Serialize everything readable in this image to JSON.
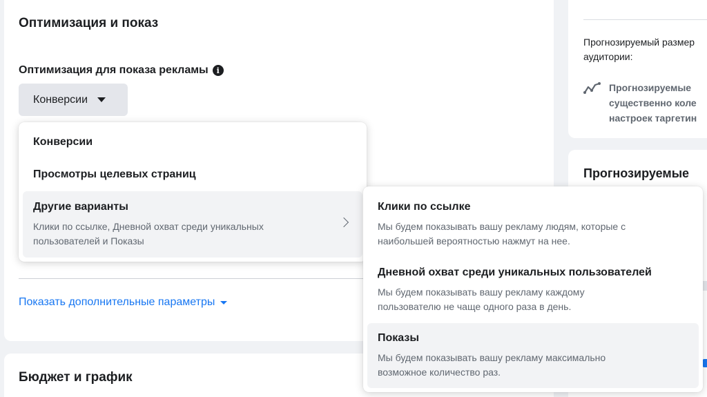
{
  "optimization": {
    "section_title": "Оптимизация и показ",
    "field_label": "Оптимизация для показа рекламы",
    "info_icon": "info-icon",
    "selected_value": "Конверсии",
    "show_more_link": "Показать дополнительные параметры"
  },
  "dropdown": {
    "items": [
      {
        "title": "Конверсии"
      },
      {
        "title": "Просмотры целевых страниц"
      },
      {
        "title": "Другие варианты",
        "description_line1": "Клики по ссылке, Дневной охват среди уникальных",
        "description_line2": "пользователей и Показы"
      }
    ]
  },
  "submenu": {
    "items": [
      {
        "title": "Клики по ссылке",
        "description_line1": "Мы будем показывать вашу рекламу людям, которые с",
        "description_line2": "наибольшей вероятностью нажмут на нее."
      },
      {
        "title": "Дневной охват среди уникальных пользователей",
        "description_line1": "Мы будем показывать вашу рекламу каждому",
        "description_line2": "пользователю не чаще одного раза в день."
      },
      {
        "title": "Показы",
        "description_line1": "Мы будем показывать вашу рекламу максимально",
        "description_line2": "возможное количество раз."
      }
    ]
  },
  "budget": {
    "section_title": "Бюджет и график"
  },
  "right_panel": {
    "audience_label_line1": "Прогнозируемый размер",
    "audience_label_line2": "аудитории:",
    "notice_line1": "Прогнозируемые",
    "notice_line2": "существенно коле",
    "notice_line3": "настроек таргетин",
    "results_heading": "Прогнозируемые"
  },
  "colors": {
    "link": "#1877f2",
    "page_bg": "#f0f2f5",
    "muted_text": "#606770"
  }
}
